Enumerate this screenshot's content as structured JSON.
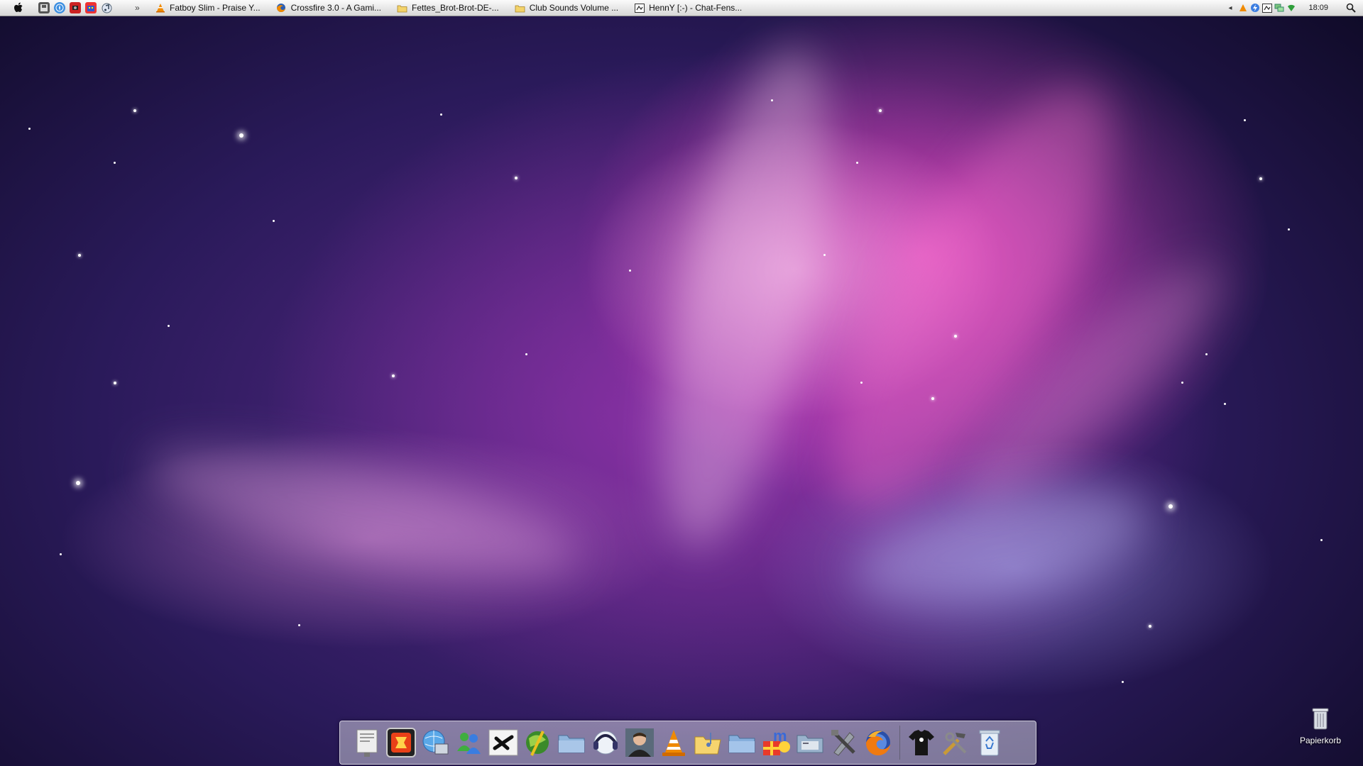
{
  "taskbar": {
    "apple_icon": "apple-icon",
    "quick_launch": [
      "disk-utility-icon",
      "safari-icon",
      "photobooth-icon",
      "calendar-icon",
      "itunes-icon"
    ],
    "overflow_label": "»",
    "tasks": [
      {
        "icon": "vlc-cone-icon",
        "label": "Fatboy Slim - Praise Y..."
      },
      {
        "icon": "firefox-icon",
        "label": "Crossfire 3.0 - A Gami..."
      },
      {
        "icon": "folder-icon",
        "label": "Fettes_Brot-Brot-DE-..."
      },
      {
        "icon": "folder-icon",
        "label": "Club Sounds Volume ..."
      },
      {
        "icon": "chat-window-icon",
        "label": "HennY [:-) - Chat-Fens..."
      }
    ],
    "tray": {
      "left_arrow": "◂",
      "icons": [
        "vlc-tray-icon",
        "flash-icon",
        "chat-tray-icon",
        "network-icon",
        "wifi-icon"
      ],
      "clock": "18:09",
      "search_icon": "spotlight-search-icon"
    }
  },
  "dock": {
    "items": [
      "preview-icon",
      "gadget-icon",
      "network-globe-icon",
      "messenger-people-icon",
      "x-app-icon",
      "globe-tool-icon",
      "folder-stack-icon",
      "headset-icon",
      "contact-photo-icon",
      "vlc-icon",
      "music-folder-icon",
      "documents-folder-icon",
      "msn-icon",
      "downloads-folder-icon",
      "system-tools-icon",
      "firefox-icon",
      "separator",
      "tshirt-icon",
      "tools-icon",
      "recycle-bin-icon"
    ]
  },
  "desktop": {
    "trash_label": "Papierkorb"
  },
  "colors": {
    "taskbar_top": "#fbfbfb",
    "taskbar_bottom": "#d6d6d6",
    "wallpaper_magenta": "#e846be",
    "wallpaper_dark": "#0e0a25"
  }
}
